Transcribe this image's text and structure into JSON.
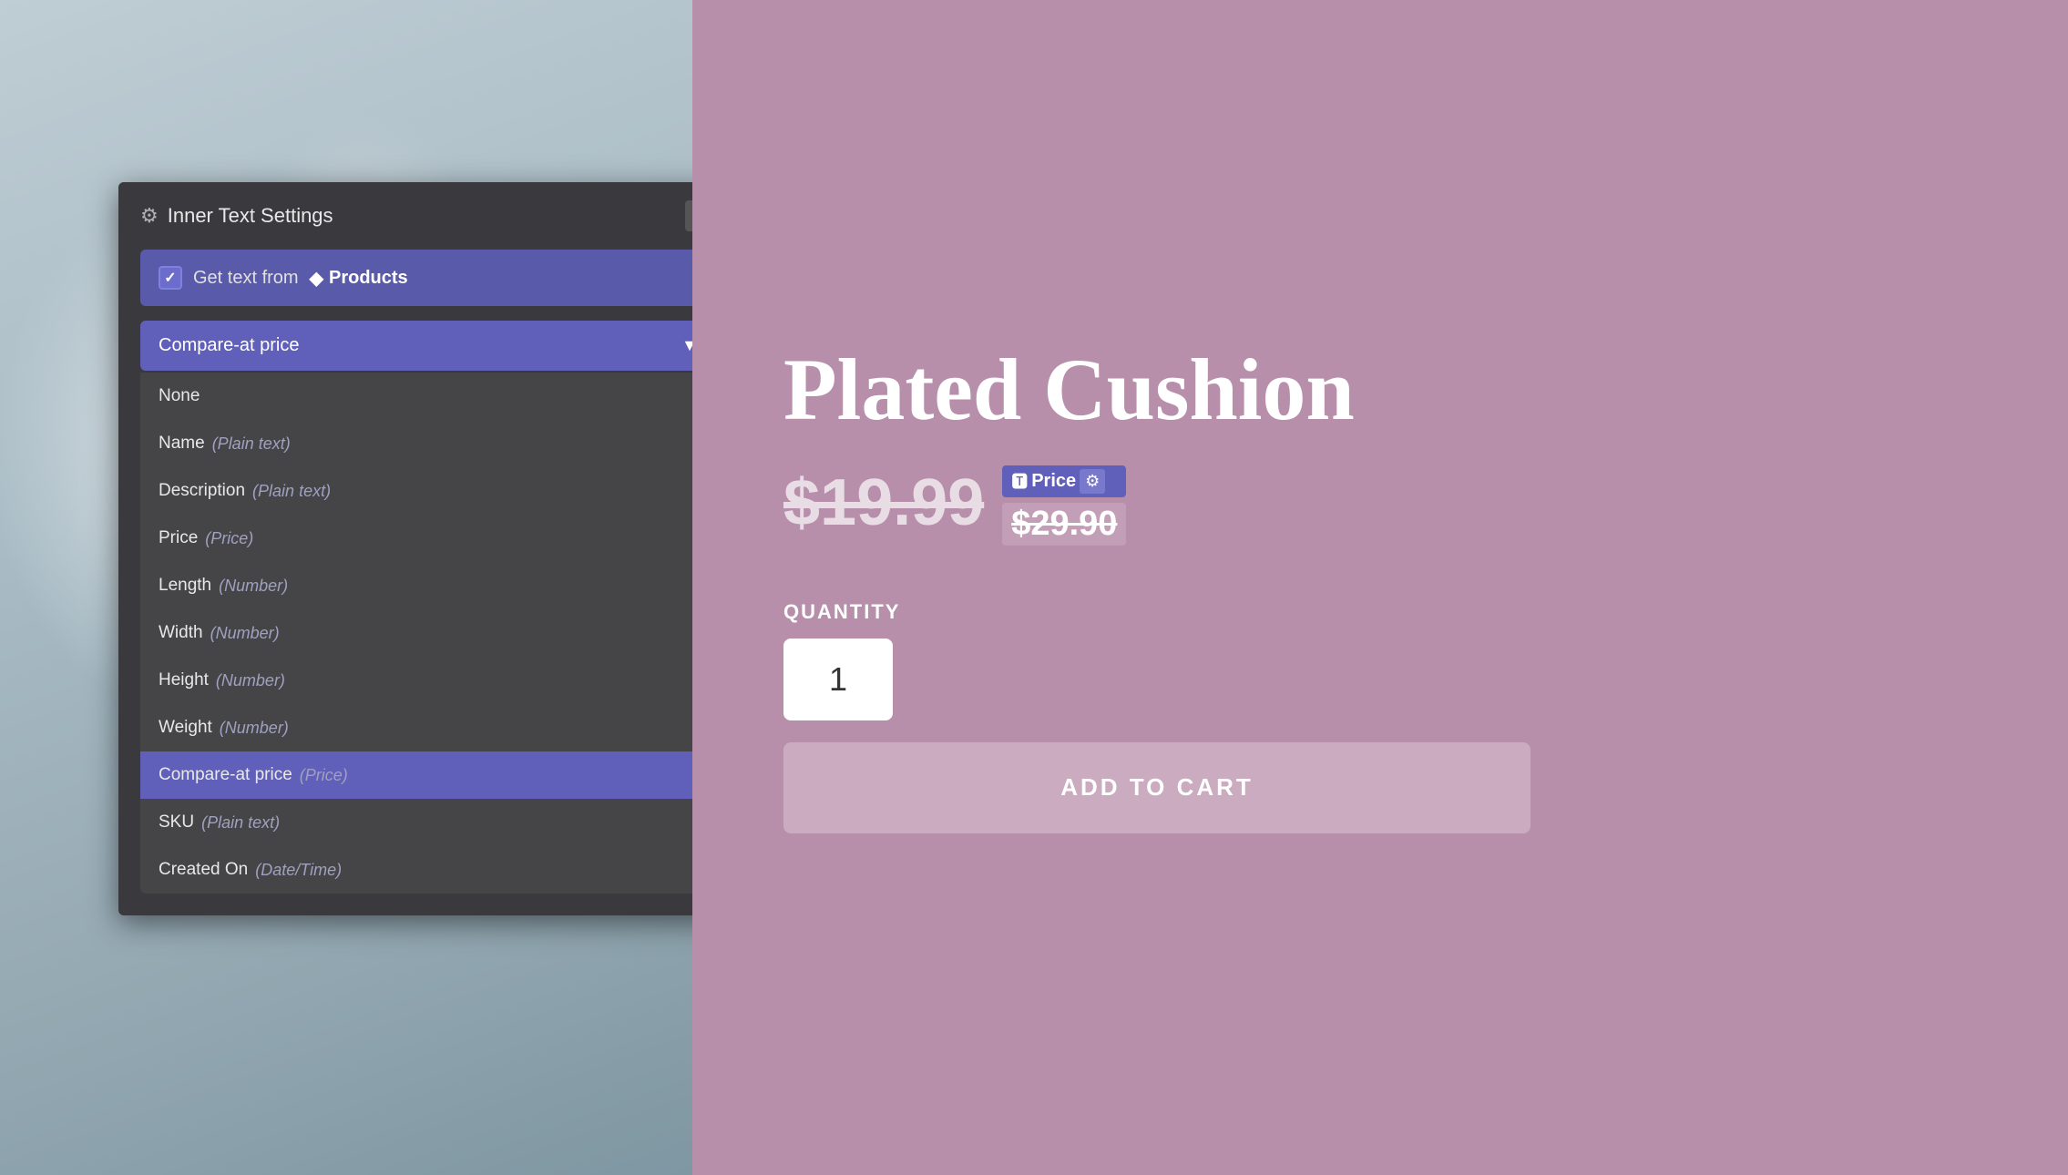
{
  "modal": {
    "title": "Inner Text Settings",
    "close_label": "×",
    "checkbox_label": "Get text from",
    "products_label": "Products",
    "selected_option": "Compare-at price",
    "dropdown_options": [
      {
        "id": "none",
        "label": "None",
        "type": ""
      },
      {
        "id": "name",
        "label": "Name",
        "type": "(Plain text)"
      },
      {
        "id": "description",
        "label": "Description",
        "type": "(Plain text)"
      },
      {
        "id": "price",
        "label": "Price",
        "type": "(Price)"
      },
      {
        "id": "length",
        "label": "Length",
        "type": "(Number)"
      },
      {
        "id": "width",
        "label": "Width",
        "type": "(Number)"
      },
      {
        "id": "height",
        "label": "Height",
        "type": "(Number)"
      },
      {
        "id": "weight",
        "label": "Weight",
        "type": "(Number)"
      },
      {
        "id": "compare-at-price",
        "label": "Compare-at price",
        "type": "(Price)"
      },
      {
        "id": "sku",
        "label": "SKU",
        "type": "(Plain text)"
      },
      {
        "id": "created-on",
        "label": "Created On",
        "type": "(Date/Time)"
      }
    ]
  },
  "product": {
    "title": "Plated Cushion",
    "price": "$19.99",
    "price_label": "Price",
    "compare_price": "$29.90",
    "quantity_label": "QUANTITY",
    "quantity_value": "1",
    "add_to_cart": "ADD TO CART"
  },
  "icons": {
    "gear": "⚙",
    "close": "×",
    "check": "✓",
    "pin": "◆",
    "dropdown_arrow": "▼",
    "price_icon": "🅣"
  }
}
